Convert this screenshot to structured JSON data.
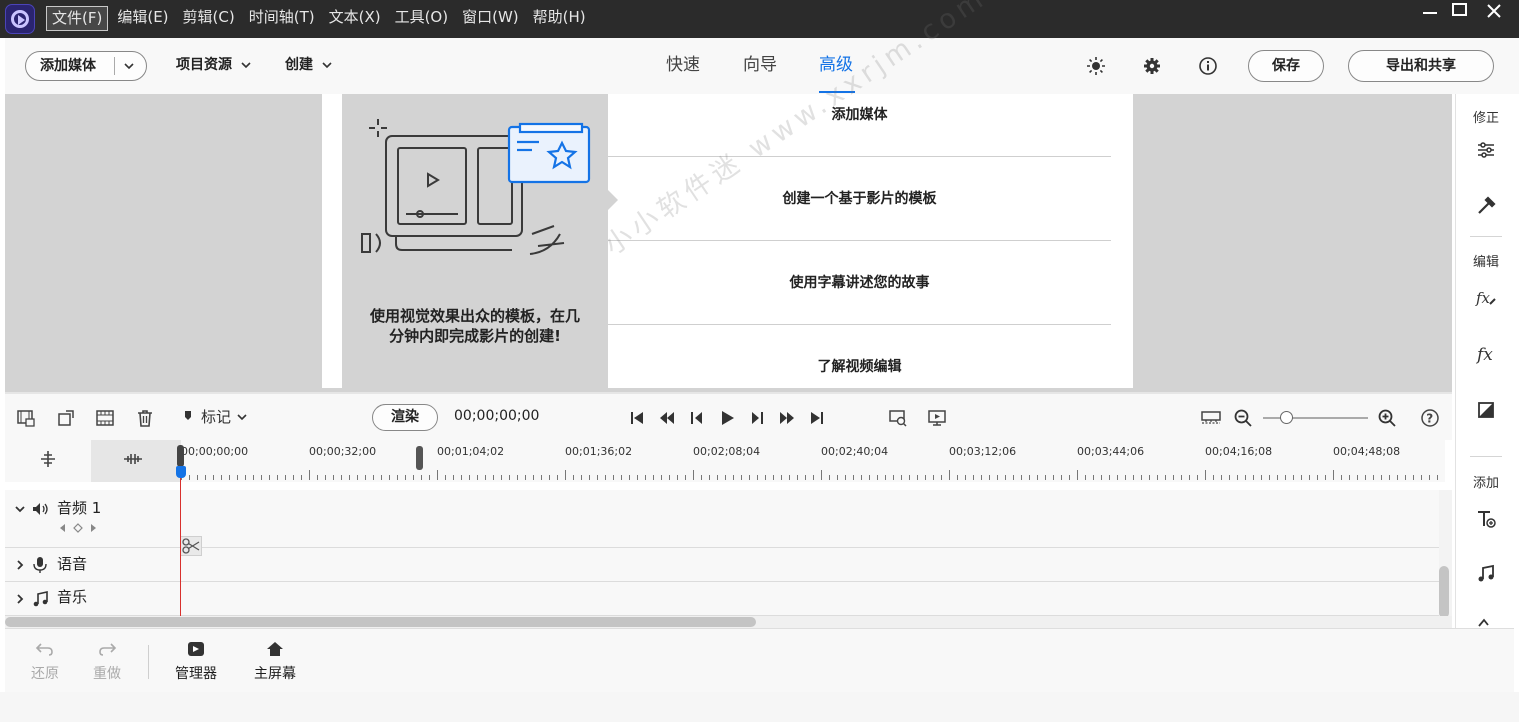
{
  "menubar": {
    "items": [
      {
        "label": "文件(F)",
        "active": true
      },
      {
        "label": "编辑(E)",
        "active": false
      },
      {
        "label": "剪辑(C)",
        "active": false
      },
      {
        "label": "时间轴(T)",
        "active": false
      },
      {
        "label": "文本(X)",
        "active": false
      },
      {
        "label": "工具(O)",
        "active": false
      },
      {
        "label": "窗口(W)",
        "active": false
      },
      {
        "label": "帮助(H)",
        "active": false
      }
    ]
  },
  "toolbar": {
    "add_media_label": "添加媒体",
    "project_assets_label": "项目资源",
    "create_label": "创建",
    "modes": [
      {
        "label": "快速",
        "active": false
      },
      {
        "label": "向导",
        "active": false
      },
      {
        "label": "高级",
        "active": true
      }
    ],
    "save_label": "保存",
    "export_label": "导出和共享"
  },
  "guide": {
    "caption_line1": "使用视觉效果出众的模板，在几",
    "caption_line2": "分钟内即完成影片的创建!",
    "items": [
      "添加媒体",
      "创建一个基于影片的模板",
      "使用字幕讲述您的故事",
      "了解视频编辑"
    ]
  },
  "right_panel": {
    "adjust_label": "修正",
    "edit_label": "编辑",
    "add_label": "添加"
  },
  "timeline_toolbar": {
    "marker_label": "标记",
    "render_label": "渲染",
    "timecode": "00;00;00;00"
  },
  "ruler": {
    "labels": [
      "00;00;00;00",
      "00;00;32;00",
      "00;01;04;02",
      "00;01;36;02",
      "00;02;08;04",
      "00;02;40;04",
      "00;03;12;06",
      "00;03;44;06",
      "00;04;16;08",
      "00;04;48;08"
    ]
  },
  "tracks": {
    "audio1_label": "音频 1",
    "voice_label": "语音",
    "music_label": "音乐"
  },
  "bottom_bar": {
    "undo_label": "还原",
    "redo_label": "重做",
    "organizer_label": "管理器",
    "home_label": "主屏幕"
  },
  "watermark": "小小软件迷 www.xxrjm.com",
  "colors": {
    "accent": "#1473e6",
    "menubar_bg": "#2b2b2b",
    "monitor_bg": "#d3d3d3",
    "playhead": "#d8302d"
  }
}
